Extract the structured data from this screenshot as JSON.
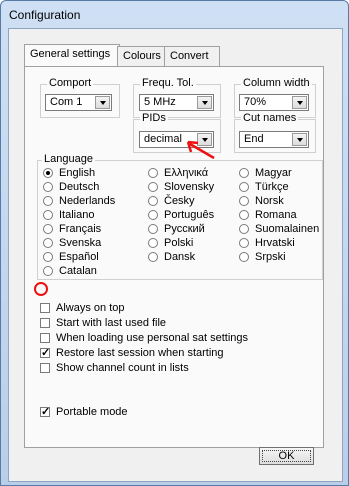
{
  "window": {
    "title": "Configuration"
  },
  "tabs": [
    "General settings",
    "Colours",
    "Convert"
  ],
  "comport": {
    "label": "Comport",
    "value": "Com 1"
  },
  "frequ_tol": {
    "label": "Frequ. Tol.",
    "value": "5 MHz"
  },
  "column_width": {
    "label": "Column width",
    "value": "70%"
  },
  "pids": {
    "label": "PIDs",
    "value": "decimal"
  },
  "cut_names": {
    "label": "Cut names",
    "value": "End"
  },
  "language": {
    "label": "Language",
    "options": [
      "English",
      "Deutsch",
      "Nederlands",
      "Italiano",
      "Français",
      "Svenska",
      "Español",
      "Catalan",
      "Ελληνικά",
      "Slovensky",
      "Česky",
      "Português",
      "Русский",
      "Polski",
      "Dansk",
      "Magyar",
      "Türkçe",
      "Norsk",
      "Romana",
      "Suomalainen",
      "Hrvatski",
      "Srpski"
    ],
    "selected": "English"
  },
  "checkboxes": [
    {
      "label": "Always on top",
      "checked": false
    },
    {
      "label": "Start with last used file",
      "checked": false
    },
    {
      "label": "When loading use personal sat settings",
      "checked": false
    },
    {
      "label": "Restore last session when starting",
      "checked": true
    },
    {
      "label": "Show channel count in lists",
      "checked": false
    }
  ],
  "portable_mode": {
    "label": "Portable mode",
    "checked": true
  },
  "ok_label": "OK",
  "annotations": {
    "color": "#ee1111"
  }
}
